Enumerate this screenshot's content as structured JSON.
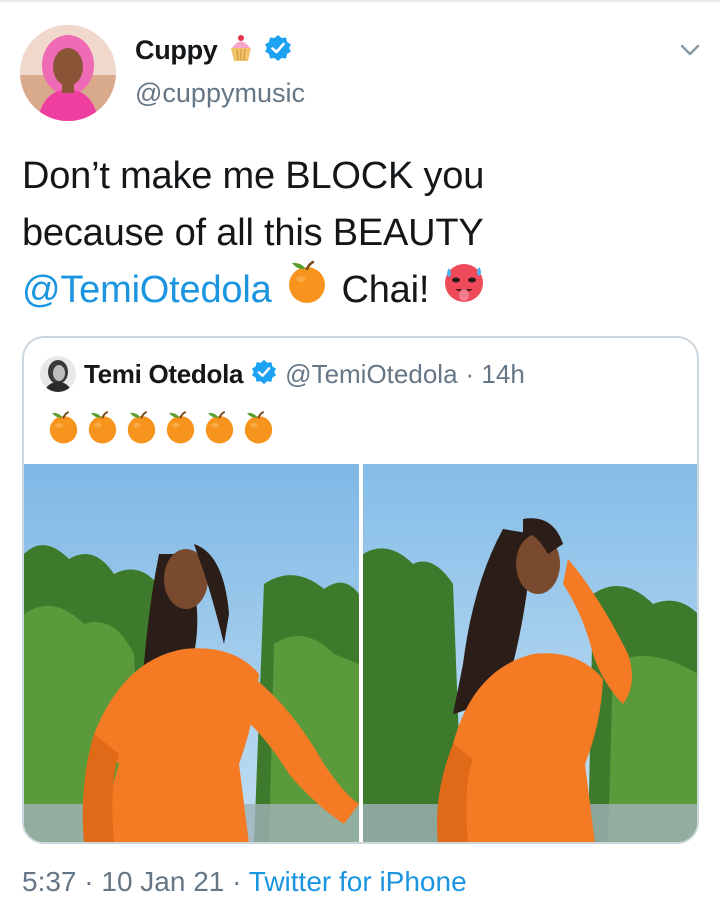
{
  "tweet": {
    "author": {
      "display_name": "Cuppy",
      "emoji": "cupcake-emoji",
      "verified": true,
      "handle": "@cuppymusic"
    },
    "menu_icon": "chevron-down-icon",
    "text": {
      "line1": "Don’t make me BLOCK you",
      "line2": "because of all this BEAUTY",
      "mention": "@TemiOtedola",
      "exclamation": "Chai!",
      "emojis": [
        "tangerine-emoji",
        "hot-face-emoji"
      ]
    },
    "quoted_tweet": {
      "display_name": "Temi Otedola",
      "verified": true,
      "handle": "@TemiOtedola",
      "time_ago": "· 14h",
      "orange_count": 6,
      "images": [
        "photo-woman-orange-dress-1",
        "photo-woman-orange-dress-2"
      ]
    },
    "footer": {
      "timestamp": "5:37 · 10 Jan 21 ·",
      "source": "Twitter for iPhone"
    }
  },
  "colors": {
    "text": "#14171a",
    "secondary": "#657786",
    "link": "#1b95e0",
    "verified": "#1da1f2",
    "border": "#ccd6dd",
    "dress_orange": "#f47a24",
    "sky": "#8fc3ea",
    "foliage": "#3e7a2c"
  }
}
